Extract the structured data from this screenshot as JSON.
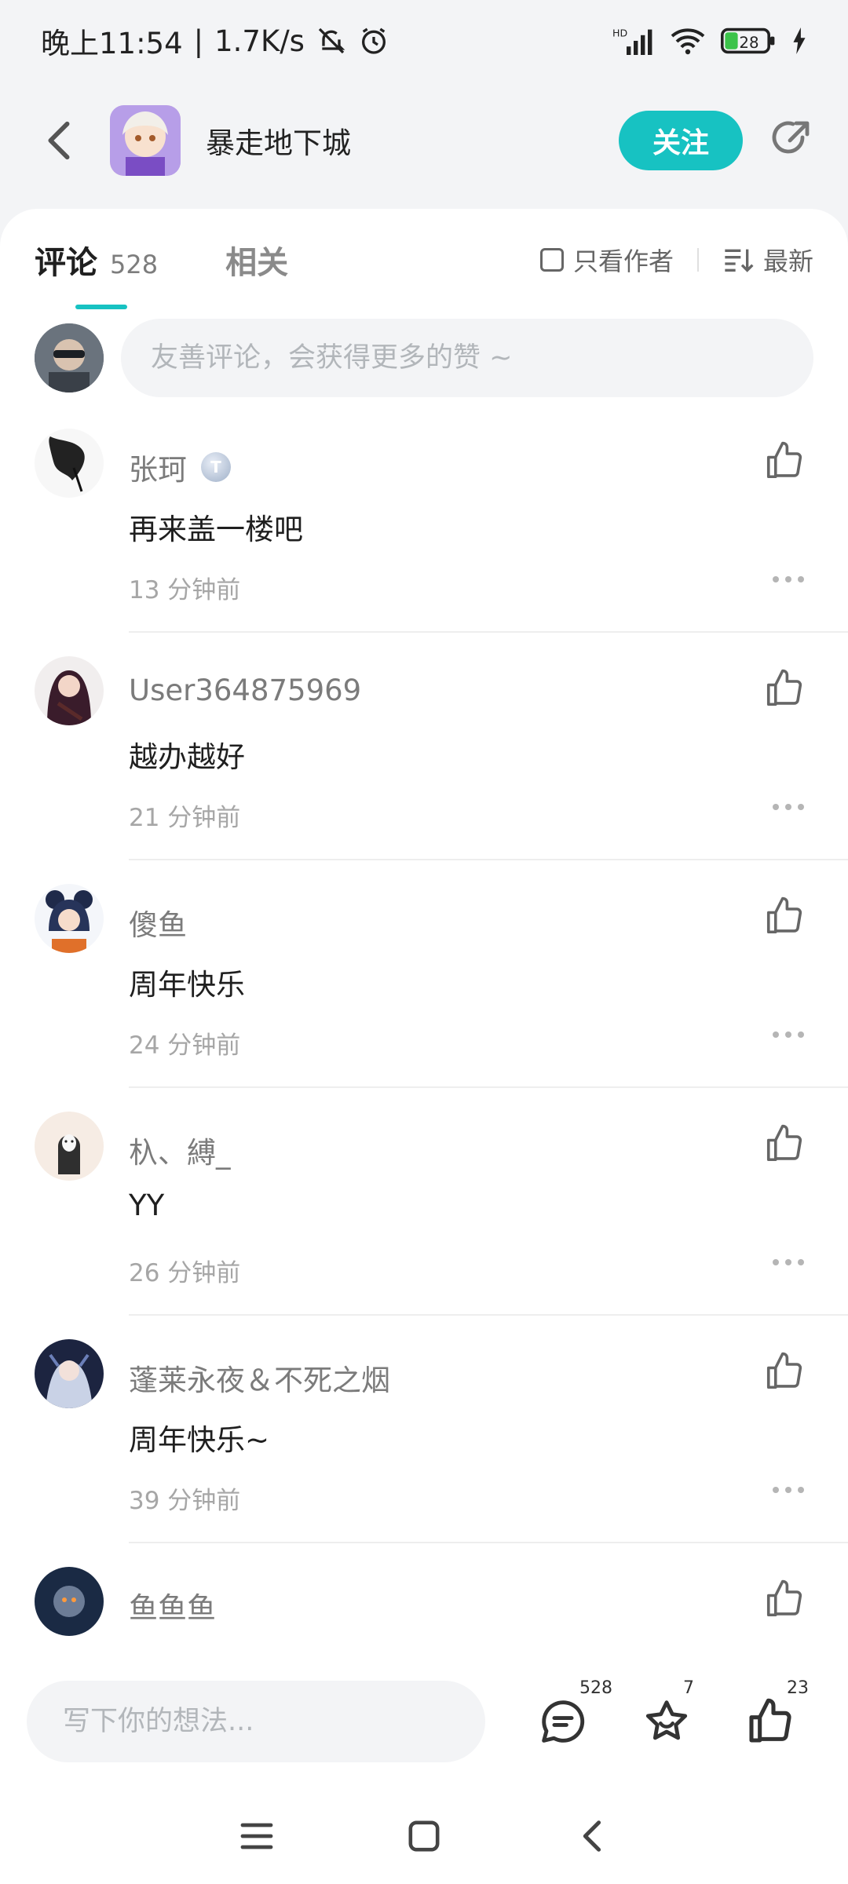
{
  "status_bar": {
    "time": "晚上11:54",
    "speed": "1.7K/s",
    "battery": "28",
    "separator": "|"
  },
  "header": {
    "title": "暴走地下城",
    "follow_label": "关注"
  },
  "tabs": {
    "comments_label": "评论",
    "comments_count": "528",
    "related_label": "相关",
    "author_only_label": "只看作者",
    "sort_label": "最新"
  },
  "comment_input": {
    "placeholder": "友善评论，会获得更多的赞 ~"
  },
  "comments": [
    {
      "name": "张珂",
      "badge": "T",
      "text": "再来盖一楼吧",
      "time": "13 分钟前"
    },
    {
      "name": "User364875969",
      "text": "越办越好",
      "time": "21 分钟前"
    },
    {
      "name": "傻鱼",
      "text": "周年快乐",
      "time": "24 分钟前"
    },
    {
      "name": "杁、縛_",
      "text": "YY",
      "time": "26 分钟前"
    },
    {
      "name": "蓬莱永夜＆不死之烟",
      "text": "周年快乐~",
      "time": "39 分钟前"
    },
    {
      "name": "鱼鱼鱼"
    }
  ],
  "bottom_bar": {
    "placeholder": "写下你的想法...",
    "comment_count": "528",
    "favorite_count": "7",
    "like_count": "23"
  },
  "colors": {
    "accent": "#17c2c2",
    "background": "#f3f4f6"
  },
  "icons": {
    "back": "chevron-left-icon",
    "share": "share-icon",
    "like": "thumbs-up-icon",
    "more": "more-dots-icon",
    "comment": "comment-bubble-icon",
    "favorite": "star-icon"
  }
}
